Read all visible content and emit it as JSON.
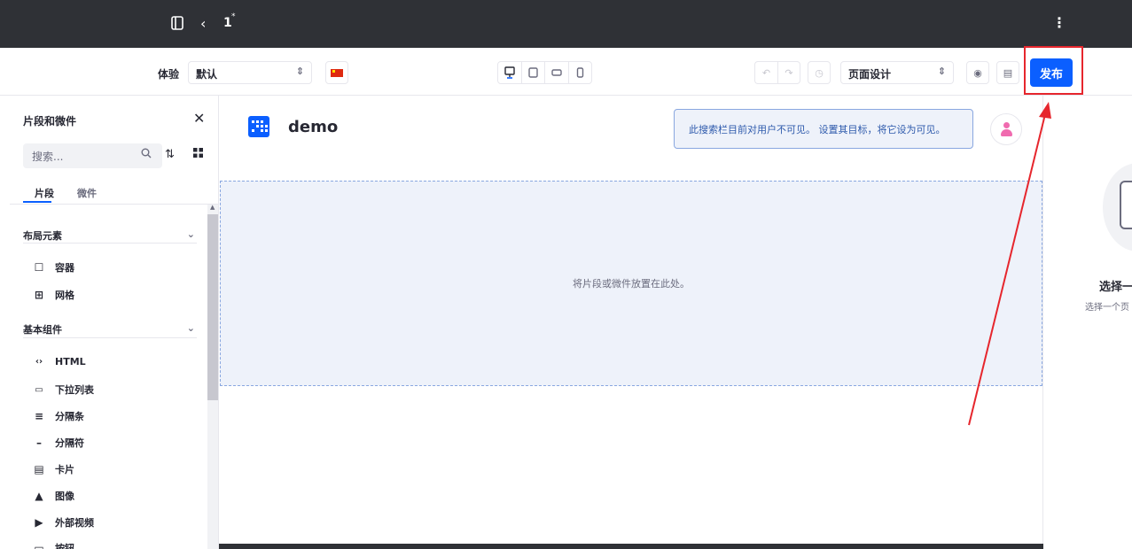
{
  "topbar": {
    "page_number": "1",
    "unsaved_mark": "*",
    "sidebar_toggle_icon": "panel-icon",
    "back_icon": "chevron-left-icon",
    "more_icon": "vertical-ellipsis-icon"
  },
  "toolbar": {
    "experience_label": "体验",
    "experience_value": "默认",
    "language_flag": "zh-CN",
    "device_icons": [
      "desktop-icon",
      "tablet-icon",
      "landscape-phone-icon",
      "portrait-phone-icon"
    ],
    "undo_icon": "undo-icon",
    "redo_icon": "redo-icon",
    "history_icon": "history-icon",
    "mode_value": "页面设计",
    "preview_icon": "eye-icon",
    "save_icon": "save-icon",
    "publish_label": "发布"
  },
  "sidebar": {
    "title": "片段和微件",
    "search_placeholder": "搜索...",
    "tabs": [
      "片段",
      "微件"
    ],
    "categories": [
      {
        "name": "布局元素",
        "items": [
          {
            "label": "容器",
            "icon": "container-icon"
          },
          {
            "label": "网格",
            "icon": "grid-icon"
          }
        ]
      },
      {
        "name": "基本组件",
        "items": [
          {
            "label": "HTML",
            "icon": "code-icon"
          },
          {
            "label": "下拉列表",
            "icon": "dropdown-icon"
          },
          {
            "label": "分隔条",
            "icon": "separator-bars-icon"
          },
          {
            "label": "分隔符",
            "icon": "separator-line-icon"
          },
          {
            "label": "卡片",
            "icon": "card-icon"
          },
          {
            "label": "图像",
            "icon": "image-icon"
          },
          {
            "label": "外部视频",
            "icon": "video-icon"
          },
          {
            "label": "按钮",
            "icon": "button-icon"
          }
        ]
      }
    ]
  },
  "canvas": {
    "site_name": "demo",
    "search_notice": "此搜索栏目前对用户不可见。 设置其目标，将它设为可见。",
    "dropzone_text": "将片段或微件放置在此处。"
  },
  "right_panel": {
    "title": "选择一",
    "subtitle": "选择一个页"
  },
  "colors": {
    "accent": "#0b5fff",
    "annotation_red": "#e6262d",
    "topbar": "#2f3136"
  }
}
